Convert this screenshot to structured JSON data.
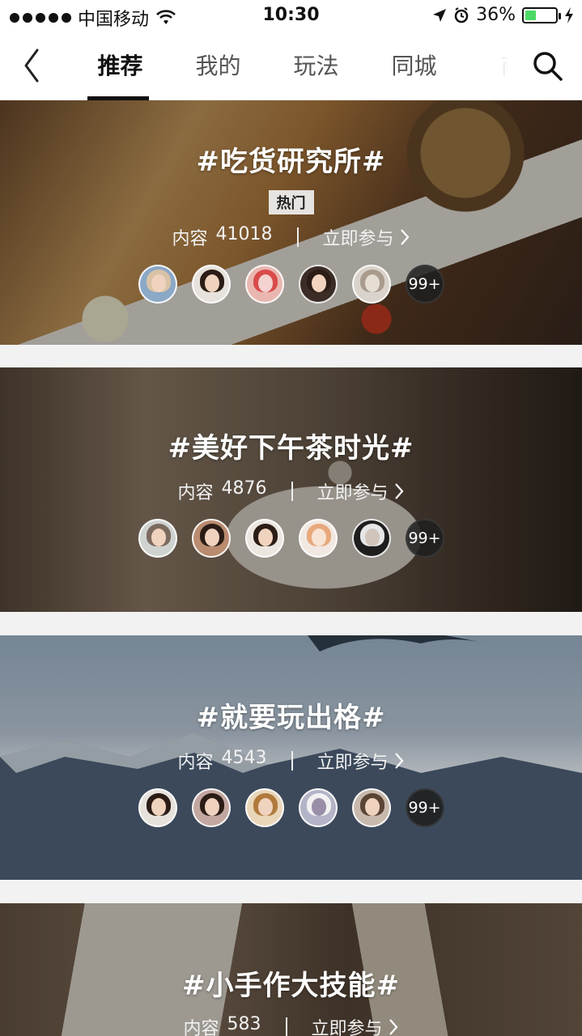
{
  "status_bar": {
    "carrier": "中国移动",
    "time": "10:30",
    "battery_percent": "36%",
    "battery_level": 0.36,
    "battery_color": "#4cd964"
  },
  "nav": {
    "back_icon": "chevron-left-icon",
    "search_icon": "search-icon",
    "tabs": [
      {
        "label": "推荐",
        "active": true
      },
      {
        "label": "我的",
        "active": false
      },
      {
        "label": "玩法",
        "active": false
      },
      {
        "label": "同城",
        "active": false
      },
      {
        "label": "商",
        "active": false
      }
    ]
  },
  "topics": [
    {
      "title": "#吃货研究所#",
      "badge": "热门",
      "content_label": "内容",
      "count": "41018",
      "join_label": "立即参与",
      "more": "99+"
    },
    {
      "title": "#美好下午茶时光#",
      "content_label": "内容",
      "count": "4876",
      "join_label": "立即参与",
      "more": "99+"
    },
    {
      "title": "#就要玩出格#",
      "content_label": "内容",
      "count": "4543",
      "join_label": "立即参与",
      "more": "99+"
    },
    {
      "title": "#小手作大技能#",
      "content_label": "内容",
      "count": "583",
      "join_label": "立即参与"
    }
  ]
}
